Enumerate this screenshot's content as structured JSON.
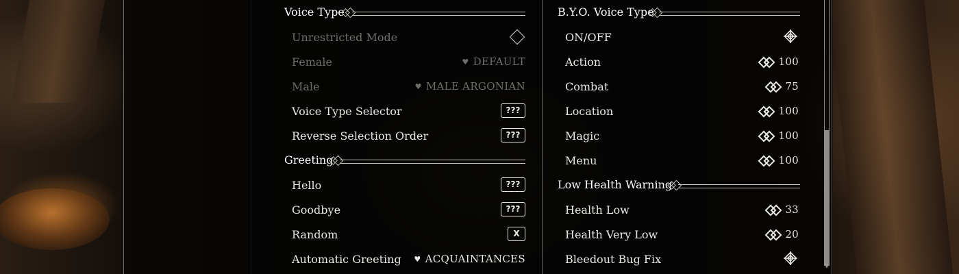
{
  "left_column": {
    "voice_type_header": "Voice Type",
    "unrestricted_mode": {
      "label": "Unrestricted Mode",
      "checked": false
    },
    "female": {
      "label": "Female",
      "value": "DEFAULT"
    },
    "male": {
      "label": "Male",
      "value": "MALE ARGONIAN"
    },
    "voice_type_selector": {
      "label": "Voice Type Selector",
      "key": "???"
    },
    "reverse_selection_order": {
      "label": "Reverse Selection Order",
      "key": "???"
    },
    "greeting_header": "Greeting",
    "hello": {
      "label": "Hello",
      "key": "???"
    },
    "goodbye": {
      "label": "Goodbye",
      "key": "???"
    },
    "random": {
      "label": "Random",
      "key": "X"
    },
    "automatic_greeting": {
      "label": "Automatic Greeting",
      "value": "ACQUAINTANCES"
    }
  },
  "right_column": {
    "byo_voice_type_header": "B.Y.O. Voice Type",
    "on_off": {
      "label": "ON/OFF",
      "checked": true
    },
    "action": {
      "label": "Action",
      "value": "100"
    },
    "combat": {
      "label": "Combat",
      "value": "75"
    },
    "location": {
      "label": "Location",
      "value": "100"
    },
    "magic": {
      "label": "Magic",
      "value": "100"
    },
    "menu": {
      "label": "Menu",
      "value": "100"
    },
    "low_health_warning_header": "Low Health Warning",
    "health_low": {
      "label": "Health Low",
      "value": "33"
    },
    "health_very_low": {
      "label": "Health Very Low",
      "value": "20"
    },
    "bleedout_bug_fix": {
      "label": "Bleedout Bug Fix",
      "checked": true
    }
  },
  "scrollbar": {
    "position": 0.49
  },
  "colors": {
    "text": "#e9e8e4",
    "disabled_text": "#6f6e6a",
    "panel_bg": "#080808",
    "line": "#c8c7c2"
  }
}
